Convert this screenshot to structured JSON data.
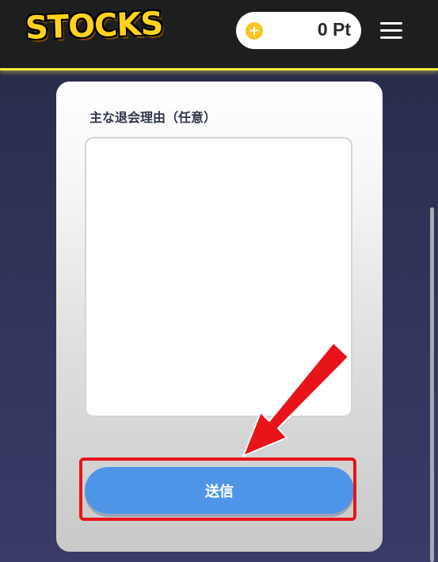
{
  "header": {
    "logo_text": "STOCKS",
    "points": {
      "value": "0 Pt",
      "coin_symbol": "+"
    }
  },
  "form": {
    "reason_label": "主な退会理由（任意）",
    "reason_value": "",
    "submit_label": "送信"
  },
  "colors": {
    "accent_yellow": "#f4ee3c",
    "button_blue": "#4e95e8",
    "annotation_red": "#e8141a"
  }
}
